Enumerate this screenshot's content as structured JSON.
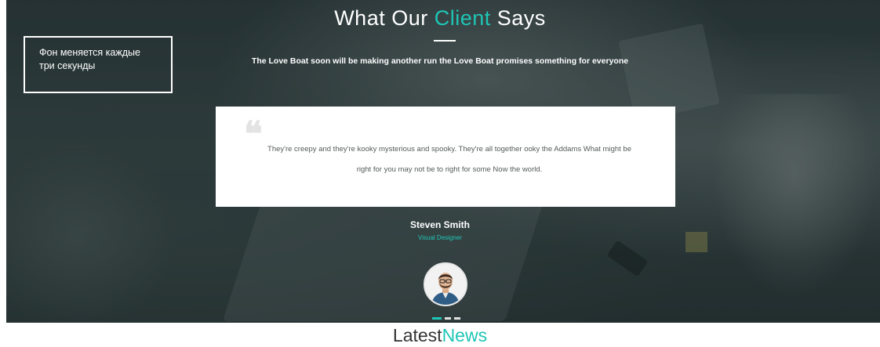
{
  "notice": {
    "text": "Фон меняется каждые три секунды"
  },
  "section": {
    "title_part1": "What Our ",
    "title_accent": "Client",
    "title_part2": " Says",
    "subtitle": "The Love Boat soon will be making another run the Love Boat promises something for everyone"
  },
  "testimonial": {
    "quote_icon": "quote-icon",
    "text": "They're creepy and they're kooky mysterious and spooky. They're all together ooky the Addams What might be right for you may not be to right for some Now the world.",
    "author_name": "Steven Smith",
    "author_role": "Visual Designer",
    "avatar_icon": "avatar-icon"
  },
  "carousel": {
    "active_index": 0,
    "count": 3
  },
  "latest_news": {
    "part1": "Latest",
    "accent": "News"
  },
  "colors": {
    "accent": "#1ec6b6",
    "card_bg": "#ffffff",
    "text_dark": "#555a5a"
  }
}
